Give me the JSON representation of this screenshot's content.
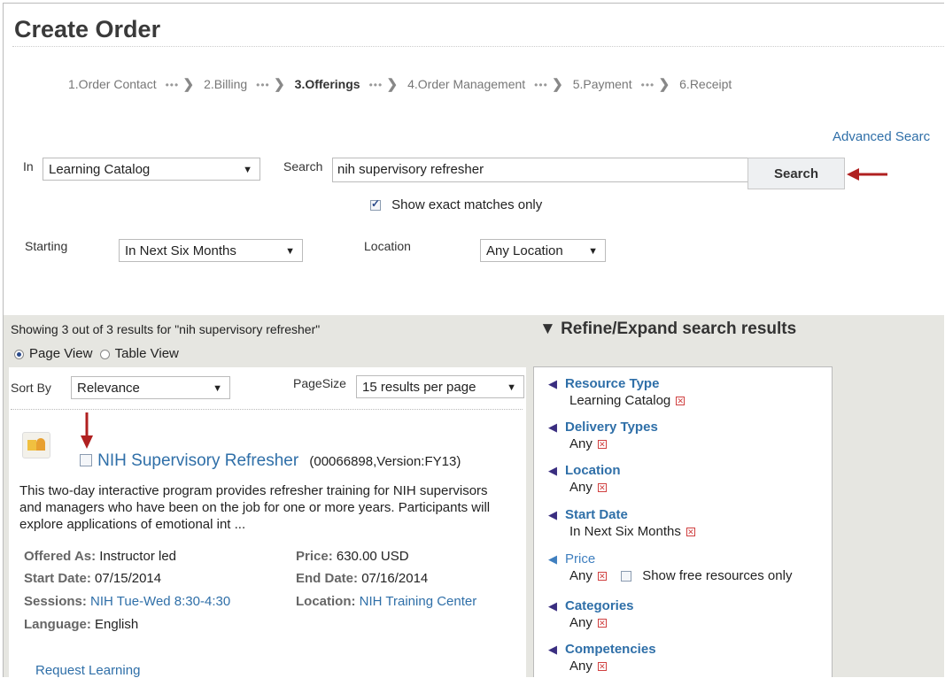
{
  "page": {
    "title": "Create Order"
  },
  "steps": [
    {
      "label": "1.Order Contact",
      "active": false
    },
    {
      "label": "2.Billing",
      "active": false
    },
    {
      "label": "3.Offerings",
      "active": true
    },
    {
      "label": "4.Order Management",
      "active": false
    },
    {
      "label": "5.Payment",
      "active": false
    },
    {
      "label": "6.Receipt",
      "active": false
    }
  ],
  "advanced_search": "Advanced Searc",
  "search": {
    "in_label": "In",
    "in_value": "Learning Catalog",
    "search_label": "Search",
    "query": "nih supervisory refresher",
    "button": "Search",
    "exact_label": "Show exact matches only",
    "starting_label": "Starting",
    "starting_value": "In Next Six Months",
    "location_label": "Location",
    "location_value": "Any Location"
  },
  "results": {
    "showing": "Showing 3 out of 3 results  for \"nih supervisory refresher\"",
    "page_view": "Page View",
    "table_view": "Table View",
    "sort_label": "Sort By",
    "sort_value": "Relevance",
    "pagesize_label": "PageSize",
    "pagesize_value": "15 results per page",
    "course": {
      "title": "NIH Supervisory Refresher",
      "code": "(00066898,Version:FY13)",
      "description": "This two-day interactive program provides refresher training for NIH supervisors and managers who have been on the job for one or more years. Participants will explore applications of emotional int  ...",
      "offered_as_label": "Offered As:",
      "offered_as": "Instructor led",
      "price_label": "Price:",
      "price": "630.00 USD",
      "start_label": "Start Date:",
      "start": "07/15/2014",
      "end_label": "End Date:",
      "end": "07/16/2014",
      "sessions_label": "Sessions:",
      "sessions": "NIH Tue-Wed 8:30-4:30",
      "location_label": "Location:",
      "location": "NIH Training Center",
      "language_label": "Language:",
      "language": "English",
      "request": "Request Learning"
    }
  },
  "refine": {
    "title": "▼ Refine/Expand search results",
    "facets": [
      {
        "name": "Resource Type",
        "value": "Learning Catalog"
      },
      {
        "name": "Delivery Types",
        "value": "Any"
      },
      {
        "name": "Location",
        "value": "Any"
      },
      {
        "name": "Start Date",
        "value": "In Next Six Months"
      },
      {
        "name": "Price",
        "value": "Any",
        "extra": "Show free resources only"
      },
      {
        "name": "Categories",
        "value": "Any"
      },
      {
        "name": "Competencies",
        "value": "Any"
      }
    ]
  },
  "colors": {
    "link": "#2f6fa8",
    "panel_bg": "#e6e6e1",
    "arrow": "#b02020"
  },
  "sep_glyph": "•••"
}
